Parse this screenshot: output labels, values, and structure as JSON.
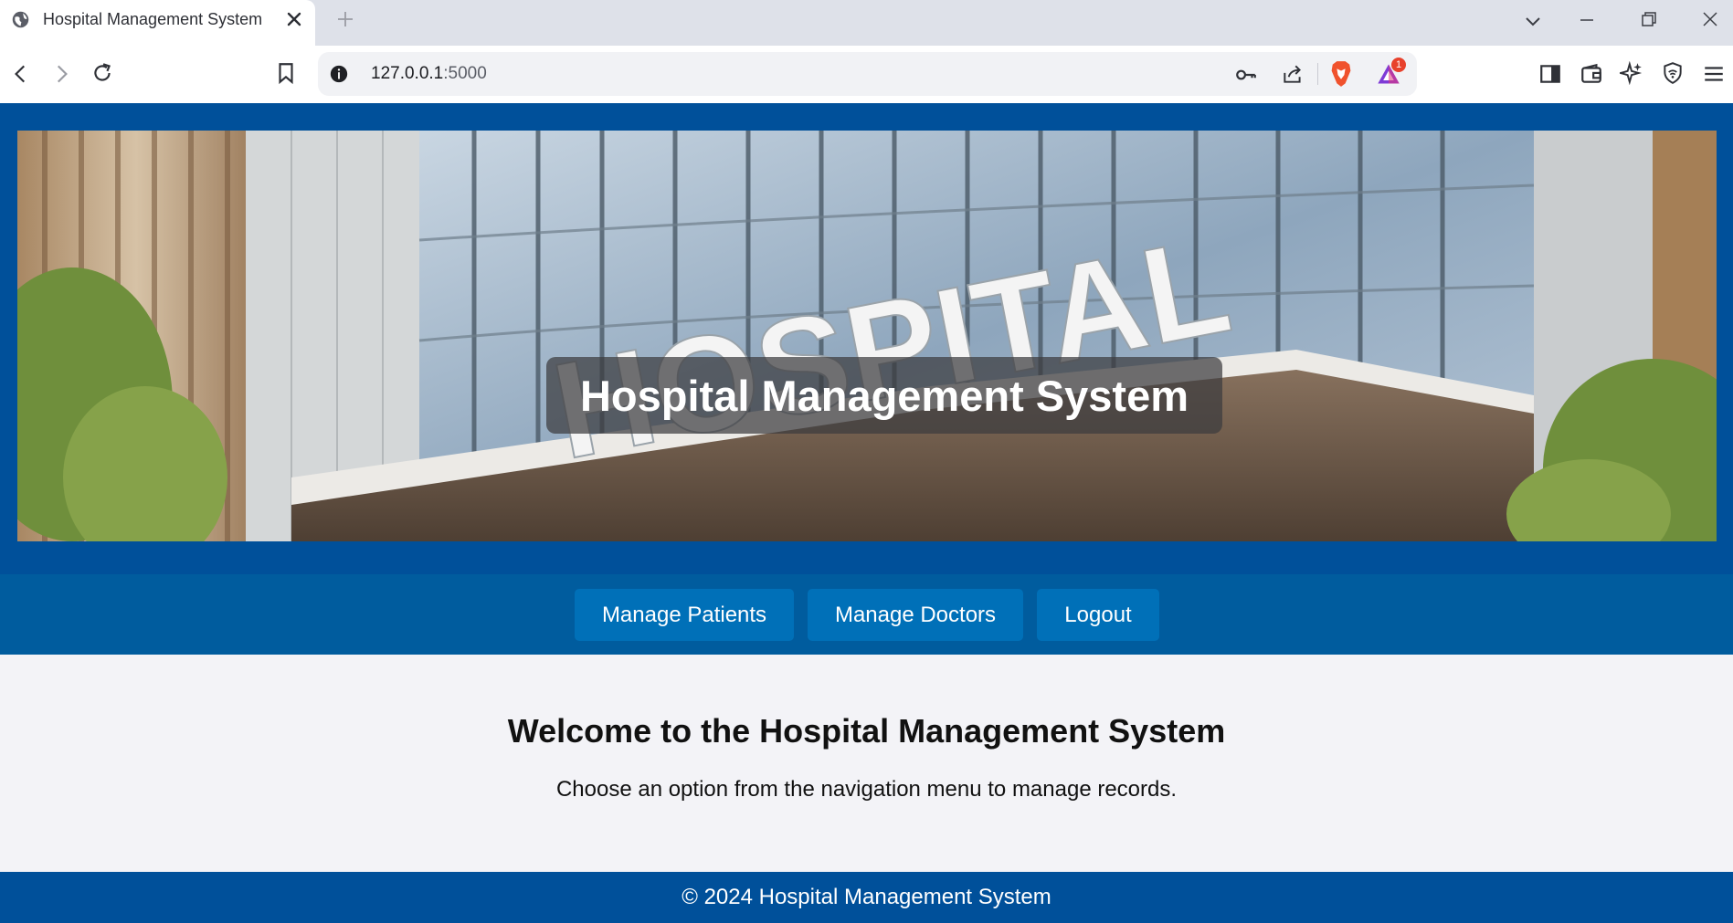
{
  "browser": {
    "tab_title": "Hospital Management System",
    "url_host": "127.0.0.1",
    "url_port": ":5000",
    "notification_count": "1"
  },
  "header": {
    "title": "Hospital Management System",
    "sign_text": "HOSPITAL"
  },
  "nav": {
    "items": [
      {
        "label": "Manage Patients"
      },
      {
        "label": "Manage Doctors"
      },
      {
        "label": "Logout"
      }
    ]
  },
  "main": {
    "heading": "Welcome to the Hospital Management System",
    "description": "Choose an option from the navigation menu to manage records."
  },
  "footer": {
    "text": "© 2024 Hospital Management System"
  },
  "colors": {
    "header_bg": "#00509a",
    "nav_bg": "#005c9e",
    "button_bg": "#0070b8",
    "content_bg": "#f3f3f7"
  }
}
